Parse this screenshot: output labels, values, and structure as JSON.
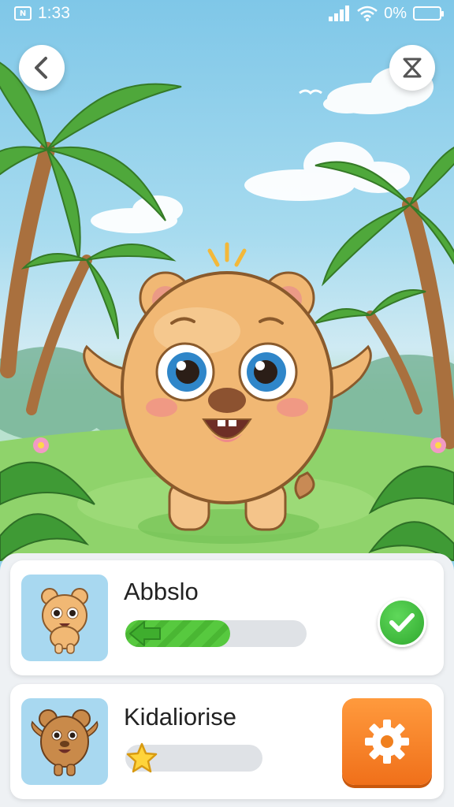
{
  "status_bar": {
    "notification_icon": "app-notification-icon",
    "time": "1:33",
    "battery_percent": "0%",
    "icons": [
      "signal-icon",
      "wifi-icon",
      "battery-icon"
    ]
  },
  "top_bar": {
    "back_icon": "chevron-left-icon",
    "close_icon": "hourglass-close-icon"
  },
  "scene": {
    "character": "orange-bear-character",
    "background": "tropical-palm-landscape"
  },
  "cards": [
    {
      "title": "Abbslo",
      "progress": 0.58,
      "progress_icon": "green-arrow-icon",
      "status_icon": "checkmark-icon",
      "accent": "#4ab733"
    },
    {
      "title": "Kidaliorise",
      "progress": 0.12,
      "progress_icon": "star-icon",
      "action_icon": "gear-icon",
      "accent": "#f0701a"
    }
  ]
}
